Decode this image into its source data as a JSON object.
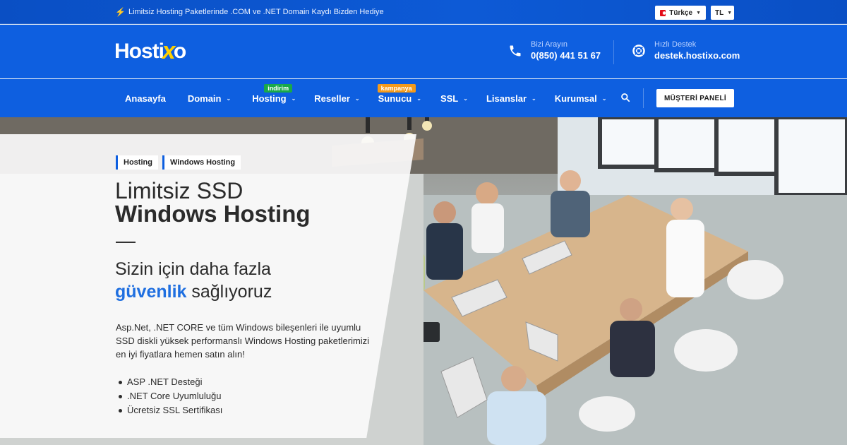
{
  "topbar": {
    "promo_text": "Limitsiz Hosting Paketlerinde .COM ve .NET Domain Kaydı Bizden Hediye",
    "language": "Türkçe",
    "currency": "TL"
  },
  "header": {
    "logo_text_a": "Hosti",
    "logo_text_x": "x",
    "logo_text_b": "o",
    "phone_label": "Bizi Arayın",
    "phone_number": "0(850) 441 51 67",
    "support_label": "Hızlı Destek",
    "support_email": "destek.hostixo.com"
  },
  "nav": {
    "items": [
      {
        "label": "Anasayfa"
      },
      {
        "label": "Domain"
      },
      {
        "label": "Hosting",
        "tag": "indirim"
      },
      {
        "label": "Reseller"
      },
      {
        "label": "Sunucu",
        "tag": "kampanya"
      },
      {
        "label": "SSL"
      },
      {
        "label": "Lisanslar"
      },
      {
        "label": "Kurumsal"
      }
    ],
    "panel_button": "MÜŞTERİ PANELİ"
  },
  "hero": {
    "breadcrumb": [
      "Hosting",
      "Windows Hosting"
    ],
    "title_light": "Limitsiz SSD",
    "title_bold": "Windows Hosting",
    "subtitle_line1": "Sizin için daha fazla",
    "subtitle_accent": "güvenlik",
    "subtitle_rest": "sağlıyoruz",
    "description": "Asp.Net, .NET CORE ve tüm Windows bileşenleri ile uyumlu SSD diskli yüksek performanslı Windows Hosting paketlerimizi en iyi fiyatlara hemen satın alın!",
    "features": [
      "ASP .NET Desteği",
      ".NET Core Uyumluluğu",
      "Ücretsiz SSL Sertifikası"
    ]
  },
  "colors": {
    "brand_blue": "#0e5fe0",
    "accent_blue": "#1f6fe0",
    "logo_yellow": "#ffd000",
    "tag_green": "#19a84a",
    "tag_orange": "#f49a1a"
  },
  "icons": {
    "promo": "lightning-icon",
    "phone": "phone-icon",
    "support": "lifebuoy-icon",
    "search": "search-icon"
  }
}
